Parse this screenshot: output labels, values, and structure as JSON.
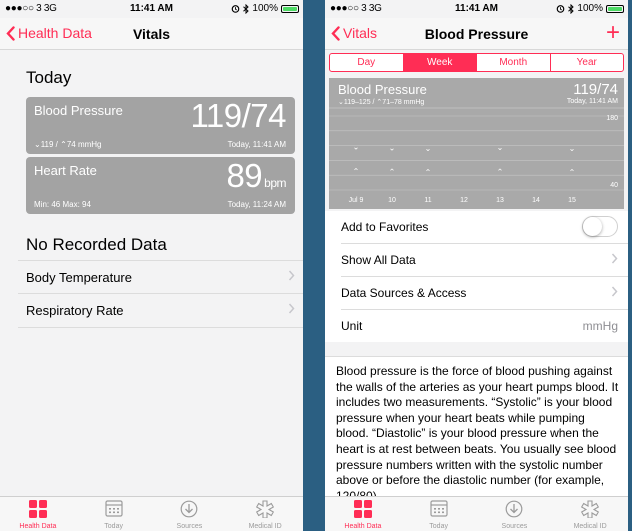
{
  "status_bar": {
    "signal": "●●●○○ 3  3G",
    "time": "11:41 AM",
    "battery": "100%"
  },
  "left": {
    "nav": {
      "back_label": "Health Data",
      "title": "Vitals"
    },
    "today_title": "Today",
    "cards": [
      {
        "title": "Blood Pressure",
        "value": "119/74",
        "unit": "",
        "sub": "⌄119 / ⌃74 mmHg",
        "time": "Today, 11:41 AM"
      },
      {
        "title": "Heart Rate",
        "value": "89",
        "unit": "bpm",
        "sub": "Min: 46  Max: 94",
        "time": "Today, 11:24 AM"
      }
    ],
    "no_data_title": "No Recorded Data",
    "list": [
      {
        "label": "Body Temperature"
      },
      {
        "label": "Respiratory Rate"
      }
    ]
  },
  "right": {
    "nav": {
      "back_label": "Vitals",
      "title": "Blood Pressure",
      "add_label": "+"
    },
    "segments": [
      "Day",
      "Week",
      "Month",
      "Year"
    ],
    "segments_selected": "Week",
    "chart_panel": {
      "title": "Blood Pressure",
      "range": "⌄119–125 / ⌃71–78 mmHg",
      "value": "119/74",
      "time": "Today, 11:41 AM"
    },
    "rows": {
      "favorites": "Add to Favorites",
      "show_all": "Show All Data",
      "sources": "Data Sources & Access",
      "unit_label": "Unit",
      "unit_value": "mmHg"
    },
    "description": "Blood pressure is the force of blood pushing against the walls of the arteries as your heart pumps blood. It includes two measurements. “Systolic” is your blood pressure when your heart beats while pumping blood. “Diastolic” is your blood pressure when the heart is at rest between beats. You usually see blood pressure numbers written with the systolic number above or before the diastolic number (for example, 120/80)."
  },
  "chart_data": {
    "type": "scatter",
    "categories": [
      "Jul 9",
      "10",
      "11",
      "12",
      "13",
      "14",
      "15"
    ],
    "ylim": [
      40,
      180
    ],
    "y_ticks": [
      "180",
      "40"
    ],
    "series": [
      {
        "marker": "⌄",
        "values": [
          122,
          120,
          119,
          null,
          121,
          null,
          119
        ]
      },
      {
        "marker": "⌃",
        "values": [
          76,
          75,
          74,
          null,
          75,
          null,
          74
        ]
      }
    ],
    "grid": true
  },
  "tabbar": {
    "items": [
      {
        "label": "Health Data",
        "icon": "health-data-icon"
      },
      {
        "label": "Today",
        "icon": "calendar-icon"
      },
      {
        "label": "Sources",
        "icon": "sources-icon"
      },
      {
        "label": "Medical ID",
        "icon": "medical-id-icon"
      }
    ],
    "active": "Health Data"
  },
  "colors": {
    "accent": "#ff2d55",
    "card_gray": "#a3a3a3",
    "background": "#2b5f82"
  }
}
